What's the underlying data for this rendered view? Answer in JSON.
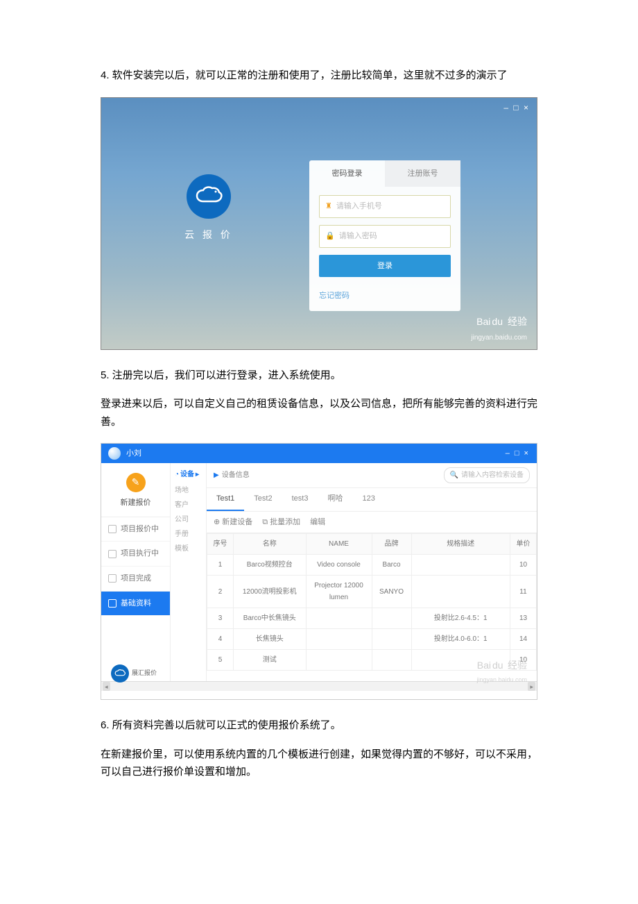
{
  "steps": {
    "s4": "4. 软件安装完以后，就可以正常的注册和使用了，注册比较简单，这里就不过多的演示了",
    "s5": "5. 注册完以后，我们可以进行登录，进入系统使用。",
    "s5b": "登录进来以后，可以自定义自己的租赁设备信息，以及公司信息，把所有能够完善的资料进行完善。",
    "s6": "6. 所有资料完善以后就可以正式的使用报价系统了。",
    "s6b": "在新建报价里，可以使用系统内置的几个模板进行创建，如果觉得内置的不够好，可以不采用，可以自己进行报价单设置和增加。"
  },
  "ss1": {
    "winbtn": "– □ ×",
    "appName": "云 报 价",
    "tabs": {
      "pwd": "密码登录",
      "reg": "注册账号"
    },
    "ph": {
      "phone": "请输入手机号",
      "pass": "请输入密码"
    },
    "loginBtn": "登录",
    "forgot": "忘记密码",
    "wm": {
      "brand": "Bai",
      "brand2": "du",
      "tag": "经验",
      "url": "jingyan.baidu.com"
    }
  },
  "ss2": {
    "user": "小刘",
    "winbtn": "– □ ×",
    "nav": {
      "newQuote": "新建报价",
      "items": [
        "项目报价中",
        "项目执行中",
        "项目完成",
        "基础资料"
      ]
    },
    "sub": {
      "head": "设备",
      "arrow": "▸",
      "items": [
        "场地",
        "客户",
        "公司",
        "手册",
        "模板"
      ]
    },
    "breadcrumb": "设备信息",
    "searchPh": "请输入内容检索设备",
    "tabs": [
      "Test1",
      "Test2",
      "test3",
      "啊哈",
      "123"
    ],
    "toolbar": {
      "newDev": "新建设备",
      "batch": "批量添加",
      "edit": "编辑"
    },
    "cols": [
      "序号",
      "名称",
      "NAME",
      "品牌",
      "规格描述",
      "单价"
    ],
    "rows": [
      {
        "no": "1",
        "name": "Barco视频控台",
        "ename": "Video console",
        "brand": "Barco",
        "spec": "",
        "price": "10"
      },
      {
        "no": "2",
        "name": "12000流明投影机",
        "ename": "Projector 12000 lumen",
        "brand": "SANYO",
        "spec": "",
        "price": "11"
      },
      {
        "no": "3",
        "name": "Barco中长焦镜头",
        "ename": "",
        "brand": "",
        "spec": "投射比2.6-4.5：1",
        "price": "13"
      },
      {
        "no": "4",
        "name": "长焦镜头",
        "ename": "",
        "brand": "",
        "spec": "投射比4.0-6.0：1",
        "price": "14"
      },
      {
        "no": "5",
        "name": "测试",
        "ename": "",
        "brand": "",
        "spec": "",
        "price": "10"
      }
    ],
    "footerBrand": "展汇报价",
    "wm": {
      "brand": "Bai",
      "brand2": "du",
      "tag": "经验",
      "url": "jingyan.baidu.com"
    }
  }
}
